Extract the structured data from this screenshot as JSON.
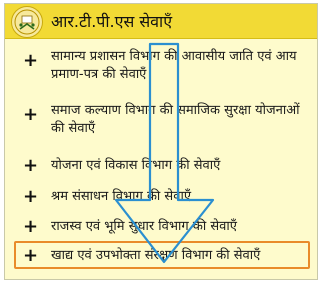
{
  "header": {
    "title": "आर.टी.पी.एस सेवाएँ",
    "logo_icon": "bihar-emblem-icon"
  },
  "services": [
    {
      "label": "सामान्य प्रशासन विभाग की आवासीय जाति एवं आय प्रमाण-पत्र की सेवाएँ"
    },
    {
      "label": "समाज कल्याण विभाग की समाजिक सुरक्षा योजनाओं की सेवाएँ"
    },
    {
      "label": "योजना एवं विकास विभाग की सेवाएँ"
    },
    {
      "label": "श्रम संसाधन विभाग की सेवाएँ"
    },
    {
      "label": "राजस्व एवं भूमि सुधार विभाग की सेवाएँ"
    },
    {
      "label": "खाद्य एवं उपभोक्ता संरक्षण विभाग की सेवाएँ"
    }
  ],
  "bullet_symbol": "+",
  "colors": {
    "header_bg": "#f2da35",
    "panel_bg": "#fefbcc",
    "highlight_border": "#e98b2a",
    "arrow_stroke": "#2b8fd0"
  }
}
